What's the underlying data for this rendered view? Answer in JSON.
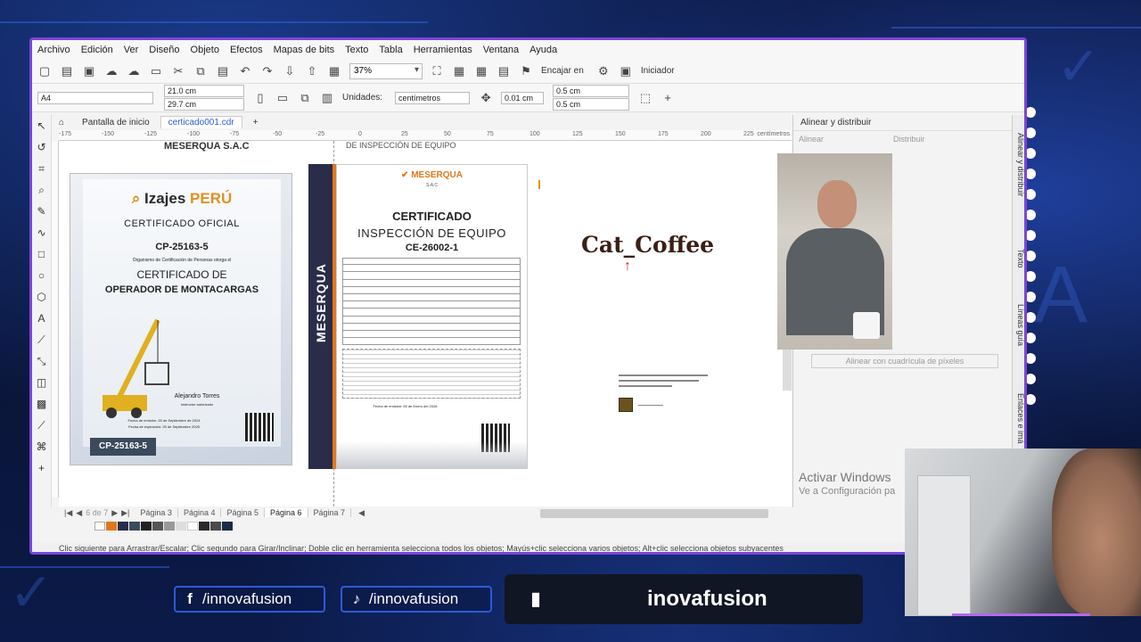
{
  "menu": [
    "Archivo",
    "Edición",
    "Ver",
    "Diseño",
    "Objeto",
    "Efectos",
    "Mapas de bits",
    "Texto",
    "Tabla",
    "Herramientas",
    "Ventana",
    "Ayuda"
  ],
  "toolbar": {
    "zoom": "37%",
    "fit_label": "Encajar en",
    "workspace_label": "Iniciador"
  },
  "propbar": {
    "paper": "A4",
    "width": "21.0 cm",
    "height": "29.7 cm",
    "units_label": "Unidades:",
    "units_value": "centímetros",
    "nudge": "0.01 cm",
    "dup_x": "0.5 cm",
    "dup_y": "0.5 cm"
  },
  "tabs": [
    "Pantalla de inicio",
    "certicado001.cdr"
  ],
  "ruler": {
    "ticks": [
      "-175",
      "-150",
      "-125",
      "-100",
      "-75",
      "-50",
      "-25",
      "0",
      "25",
      "50",
      "75",
      "100",
      "125",
      "150",
      "175",
      "200",
      "225"
    ],
    "unit": "centímetros"
  },
  "canvas": {
    "header_left": "MESERQUA S.A.C",
    "header_right": "DE INSPECCIÓN DE EQUIPO",
    "cert1": {
      "logo_main": "Izajes",
      "logo_accent": "PERÚ",
      "title": "CERTIFICADO OFICIAL",
      "code": "CP-25163-5",
      "org_text": "Organismo de Certificación de Personas otorga el",
      "subtitle": "CERTIFICADO DE",
      "role": "OPERADOR DE MONTACARGAS",
      "signer": "Alejandro Torres",
      "signer_role": "Instructor autorizado",
      "issue_date": "Fecha de emisión: 25 de Septiembre de 2024",
      "expiry_date": "Fecha de expiración: 25 de Septiembre 2025",
      "badge": "CP-25163-5"
    },
    "cert2": {
      "side_text": "MESERQUA",
      "logo": "MESERQUA",
      "logo_sub": "S.A.C",
      "title": "CERTIFICADO",
      "subtitle": "INSPECCIÓN DE EQUIPO",
      "code": "CE-26002-1",
      "date_line": "Fecha de emisión: 05 de Enero del 2026"
    },
    "logo_text": "Cat_Coffee"
  },
  "pages": [
    "Página 3",
    "Página 4",
    "Página 5",
    "Página 6",
    "Página 7"
  ],
  "page_counter": "6 de 7",
  "active_page": "Página 6",
  "status": "Clic siguiente para Arrastrar/Escalar; Clic segundo para Girar/Inclinar; Doble clic en herramienta selecciona todos los objetos; Mayús+clic selecciona varios objetos; Alt+clic selecciona objetos subyacentes",
  "docker": {
    "title": "Alinear y distribuir",
    "tab_align": "Alinear",
    "tab_distribute": "Distribuir",
    "grid_button": "Alinear con cuadrícula de píxeles",
    "side_tabs": [
      "Alinear y distribuir",
      "Texto",
      "Líneas guía",
      "Enlaces e imá"
    ]
  },
  "watermark": {
    "line1": "Activar Windows",
    "line2": "Ve a Configuración pa"
  },
  "social": {
    "facebook": "/innovafusion",
    "tiktok": "/innovafusion",
    "twitch": "inovafusion"
  },
  "colors": {
    "window_border": "#7b46d9",
    "accent_orange": "#e0781e",
    "social_border": "#2b5bd6"
  }
}
